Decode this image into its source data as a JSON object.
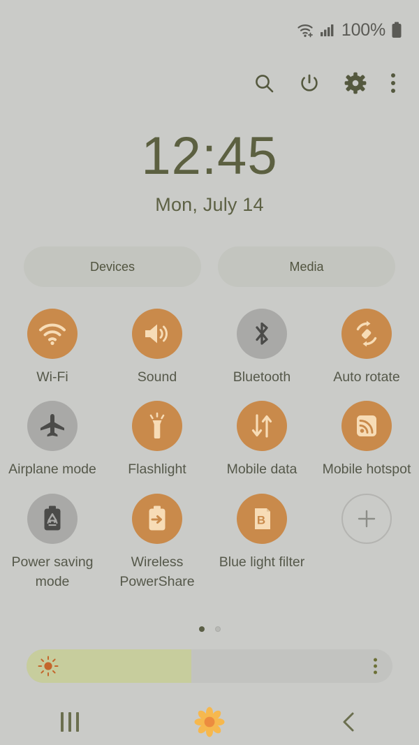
{
  "statusbar": {
    "battery_percent": "100%",
    "wifi_icon": "wifi-status-icon",
    "signal_icon": "cellular-signal-icon",
    "battery_icon": "battery-full-icon"
  },
  "header": {
    "search_icon": "search-icon",
    "power_icon": "power-icon",
    "settings_icon": "gear-icon",
    "more_icon": "more-vertical-icon"
  },
  "clock": {
    "time": "12:45",
    "date": "Mon, July 14"
  },
  "panels": {
    "devices_label": "Devices",
    "media_label": "Media"
  },
  "toggles": [
    {
      "label": "Wi-Fi",
      "icon": "wifi-icon",
      "state": "on"
    },
    {
      "label": "Sound",
      "icon": "sound-icon",
      "state": "on"
    },
    {
      "label": "Bluetooth",
      "icon": "bluetooth-icon",
      "state": "off"
    },
    {
      "label": "Auto rotate",
      "icon": "auto-rotate-icon",
      "state": "on"
    },
    {
      "label": "Airplane mode",
      "icon": "airplane-icon",
      "state": "off"
    },
    {
      "label": "Flashlight",
      "icon": "flashlight-icon",
      "state": "on"
    },
    {
      "label": "Mobile data",
      "icon": "mobile-data-icon",
      "state": "on"
    },
    {
      "label": "Mobile hotspot",
      "icon": "mobile-hotspot-icon",
      "state": "on"
    },
    {
      "label": "Power saving mode",
      "icon": "power-saving-icon",
      "state": "off"
    },
    {
      "label": "Wireless PowerShare",
      "icon": "power-share-icon",
      "state": "on"
    },
    {
      "label": "Blue light filter",
      "icon": "blue-light-icon",
      "state": "on"
    },
    {
      "label": "",
      "icon": "add-icon",
      "state": "add"
    }
  ],
  "pager": {
    "total_pages": 2,
    "current_page": 1
  },
  "brightness": {
    "value_percent": 45,
    "sun_icon": "brightness-sun-icon",
    "menu_icon": "more-vertical-icon"
  },
  "navbar": {
    "recents_label": "recents-icon",
    "home_label": "home-flower-icon",
    "back_label": "back-icon"
  },
  "colors": {
    "background": "#cacbc8",
    "accent_on": "#c98a4b",
    "icon_on": "#f7dcb6",
    "toggle_off": "#a9a9a7",
    "icon_off": "#4b4b49",
    "text": "#55584a",
    "clock_text": "#5c6041",
    "header_icon": "#55593f",
    "slider_fill": "#c7cd9d",
    "slider_track": "#c2c3c0"
  }
}
